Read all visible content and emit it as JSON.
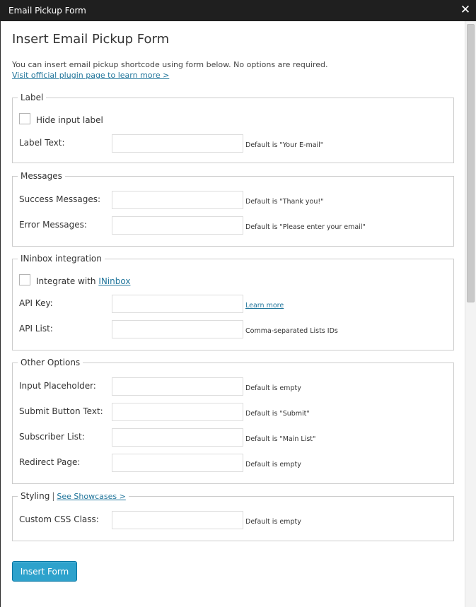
{
  "window": {
    "title": "Email Pickup Form",
    "close_glyph": "✕"
  },
  "page": {
    "title": "Insert Email Pickup Form",
    "intro": "You can insert email pickup shortcode using form below. No options are required.",
    "plugin_link": "Visit official plugin page to learn more >"
  },
  "label_group": {
    "legend": "Label",
    "hide_label_checkbox": "Hide input label",
    "label_text": {
      "label": "Label Text:",
      "value": "",
      "hint": "Default is \"Your E-mail\""
    }
  },
  "messages_group": {
    "legend": "Messages",
    "success": {
      "label": "Success Messages:",
      "value": "",
      "hint": "Default is \"Thank you!\""
    },
    "error": {
      "label": "Error Messages:",
      "value": "",
      "hint": "Default is \"Please enter your email\""
    }
  },
  "ininbox_group": {
    "legend": "INinbox integration",
    "integrate_prefix": "Integrate with ",
    "integrate_link": "INinbox",
    "api_key": {
      "label": "API Key:",
      "value": "",
      "hint_link": "Learn more"
    },
    "api_list": {
      "label": "API List:",
      "value": "",
      "hint": "Comma-separated Lists IDs"
    }
  },
  "other_group": {
    "legend": "Other Options",
    "placeholder": {
      "label": "Input Placeholder:",
      "value": "",
      "hint": "Default is empty"
    },
    "submit_text": {
      "label": "Submit Button Text:",
      "value": "",
      "hint": "Default is \"Submit\""
    },
    "subscriber_list": {
      "label": "Subscriber List:",
      "value": "",
      "hint": "Default is \"Main List\""
    },
    "redirect_page": {
      "label": "Redirect Page:",
      "value": "",
      "hint": "Default is empty"
    }
  },
  "styling_group": {
    "legend": "Styling",
    "separator": "|",
    "showcases_link": "See Showcases >",
    "css_class": {
      "label": "Custom CSS Class:",
      "value": "",
      "hint": "Default is empty"
    }
  },
  "actions": {
    "insert_label": "Insert Form"
  },
  "colors": {
    "titlebar": "#1f1f1f",
    "link": "#21759b",
    "primary_button": "#2ea2cc",
    "border": "#cccccc"
  }
}
